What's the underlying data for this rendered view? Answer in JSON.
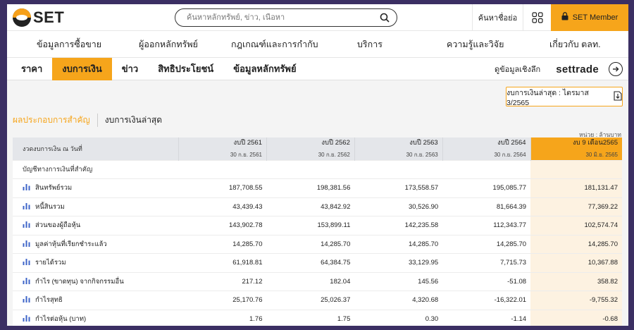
{
  "header": {
    "logo_text": "SET",
    "search_placeholder": "ค้นหาหลักทรัพย์, ข่าว, เนื้อหา",
    "quote_link": "ค้นหาชื่อย่อ",
    "member_label": "SET Member"
  },
  "main_nav": [
    "ข้อมูลการซื้อขาย",
    "ผู้ออกหลักทรัพย์",
    "กฎเกณฑ์และการกำกับ",
    "บริการ",
    "ความรู้และวิจัย",
    "เกี่ยวกับ ตลท."
  ],
  "sub_nav": {
    "tabs": [
      "ราคา",
      "งบการเงิน",
      "ข่าว",
      "สิทธิประโยชน์",
      "ข้อมูลหลักทรัพย์"
    ],
    "deep_label": "ดูข้อมูลเชิงลึก",
    "settrade_prefix": "set",
    "settrade_suffix": "trade"
  },
  "content": {
    "latest_button": "งบการเงินล่าสุด : ไตรมาส 3/2565",
    "tab_active": "ผลประกอบการสำคัญ",
    "tab_other": "งบการเงินล่าสุด",
    "unit": "หน่วย : ล้านบาท"
  },
  "table": {
    "header_label": "งวดงบการเงิน ณ วันที่",
    "columns": [
      {
        "year": "งบปี 2561",
        "date": "30 ก.ย. 2561"
      },
      {
        "year": "งบปี 2562",
        "date": "30 ก.ย. 2562"
      },
      {
        "year": "งบปี 2563",
        "date": "30 ก.ย. 2563"
      },
      {
        "year": "งบปี 2564",
        "date": "30 ก.ย. 2564"
      },
      {
        "year": "งบ 9 เดือน2565",
        "date": "30 มิ.ย. 2565"
      }
    ],
    "section_label": "บัญชีทางการเงินที่สำคัญ",
    "rows": [
      {
        "label": "สินทรัพย์รวม",
        "values": [
          "187,708.55",
          "198,381.56",
          "173,558.57",
          "195,085.77",
          "181,131.47"
        ]
      },
      {
        "label": "หนี้สินรวม",
        "values": [
          "43,439.43",
          "43,842.92",
          "30,526.90",
          "81,664.39",
          "77,369.22"
        ]
      },
      {
        "label": "ส่วนของผู้ถือหุ้น",
        "values": [
          "143,902.78",
          "153,899.11",
          "142,235.58",
          "112,343.77",
          "102,574.74"
        ]
      },
      {
        "label": "มูลค่าหุ้นที่เรียกชำระแล้ว",
        "values": [
          "14,285.70",
          "14,285.70",
          "14,285.70",
          "14,285.70",
          "14,285.70"
        ]
      },
      {
        "label": "รายได้รวม",
        "values": [
          "61,918.81",
          "64,384.75",
          "33,129.95",
          "7,715.73",
          "10,367.88"
        ]
      },
      {
        "label": "กำไร (ขาดทุน) จากกิจกรรมอื่น",
        "values": [
          "217.12",
          "182.04",
          "145.56",
          "-51.08",
          "358.82"
        ]
      },
      {
        "label": "กำไรสุทธิ",
        "values": [
          "25,170.76",
          "25,026.37",
          "4,320.68",
          "-16,322.01",
          "-9,755.32"
        ]
      },
      {
        "label": "กำไรต่อหุ้น (บาท)",
        "values": [
          "1.76",
          "1.75",
          "0.30",
          "-1.14",
          "-0.68"
        ]
      }
    ]
  },
  "colors": {
    "accent": "#f6a51b",
    "highlight_cell": "#fdf2e1",
    "chart_icon": "#3e64c8"
  }
}
